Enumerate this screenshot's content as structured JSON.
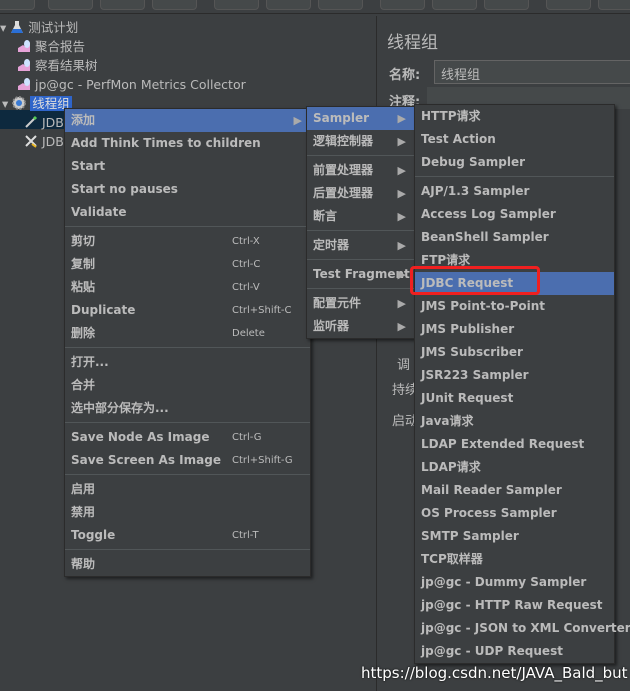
{
  "tree": {
    "items": [
      {
        "label": "测试计划",
        "icon": "test-plan-flask-icon"
      },
      {
        "label": "聚合报告",
        "icon": "listener-chart-icon"
      },
      {
        "label": "察看结果树",
        "icon": "listener-chart-icon"
      },
      {
        "label": "jp@gc - PerfMon Metrics Collector",
        "icon": "listener-chart-icon"
      },
      {
        "label": "线程组",
        "icon": "thread-group-gear-icon"
      },
      {
        "label": "JDB",
        "icon": "jdbc-dropper-icon"
      },
      {
        "label": "JDB",
        "icon": "config-tools-icon"
      }
    ]
  },
  "right_panel": {
    "title": "线程组",
    "name_label": "名称:",
    "name_value": "线程组",
    "comment_label": "注释:",
    "scheduler_label": "调",
    "duration_label": "持续",
    "startup_label": "启动"
  },
  "context_menu": [
    {
      "label": "添加",
      "submenu": true,
      "highlighted": true
    },
    {
      "sep": true
    },
    {
      "label": "Add Think Times to children"
    },
    {
      "label": "Start"
    },
    {
      "label": "Start no pauses"
    },
    {
      "label": "Validate"
    },
    {
      "sep": true
    },
    {
      "label": "剪切",
      "shortcut": "Ctrl-X"
    },
    {
      "label": "复制",
      "shortcut": "Ctrl-C"
    },
    {
      "label": "粘贴",
      "shortcut": "Ctrl-V"
    },
    {
      "label": "Duplicate",
      "shortcut": "Ctrl+Shift-C"
    },
    {
      "label": "删除",
      "shortcut": "Delete"
    },
    {
      "sep": true
    },
    {
      "label": "打开..."
    },
    {
      "label": "合并"
    },
    {
      "label": "选中部分保存为..."
    },
    {
      "sep": true
    },
    {
      "label": "Save Node As Image",
      "shortcut": "Ctrl-G"
    },
    {
      "label": "Save Screen As Image",
      "shortcut": "Ctrl+Shift-G"
    },
    {
      "sep": true
    },
    {
      "label": "启用"
    },
    {
      "label": "禁用"
    },
    {
      "label": "Toggle",
      "shortcut": "Ctrl-T"
    },
    {
      "sep": true
    },
    {
      "label": "帮助"
    }
  ],
  "add_submenu": [
    {
      "label": "Sampler",
      "submenu": true,
      "highlighted": true
    },
    {
      "label": "逻辑控制器",
      "submenu": true
    },
    {
      "sep": true
    },
    {
      "label": "前置处理器",
      "submenu": true
    },
    {
      "label": "后置处理器",
      "submenu": true
    },
    {
      "label": "断言",
      "submenu": true
    },
    {
      "sep": true
    },
    {
      "label": "定时器",
      "submenu": true
    },
    {
      "sep": true
    },
    {
      "label": "Test Fragment",
      "submenu": true
    },
    {
      "sep": true
    },
    {
      "label": "配置元件",
      "submenu": true
    },
    {
      "label": "监听器",
      "submenu": true
    }
  ],
  "sampler_submenu": [
    {
      "label": "HTTP请求"
    },
    {
      "label": "Test Action"
    },
    {
      "label": "Debug Sampler"
    },
    {
      "sep": true
    },
    {
      "label": "AJP/1.3 Sampler"
    },
    {
      "label": "Access Log Sampler"
    },
    {
      "label": "BeanShell Sampler"
    },
    {
      "label": "FTP请求"
    },
    {
      "label": "JDBC Request",
      "highlighted": true
    },
    {
      "label": "JMS Point-to-Point"
    },
    {
      "label": "JMS Publisher"
    },
    {
      "label": "JMS Subscriber"
    },
    {
      "label": "JSR223 Sampler"
    },
    {
      "label": "JUnit Request"
    },
    {
      "label": "Java请求"
    },
    {
      "label": "LDAP Extended Request"
    },
    {
      "label": "LDAP请求"
    },
    {
      "label": "Mail Reader Sampler"
    },
    {
      "label": "OS Process Sampler"
    },
    {
      "label": "SMTP Sampler"
    },
    {
      "label": "TCP取样器"
    },
    {
      "label": "jp@gc - Dummy Sampler"
    },
    {
      "label": "jp@gc - HTTP Raw Request"
    },
    {
      "label": "jp@gc - JSON to XML Converter"
    },
    {
      "label": "jp@gc - UDP Request"
    }
  ],
  "watermark": "https://blog.csdn.net/JAVA_Bald_but",
  "colors": {
    "background": "#3c3f41",
    "highlight": "#4b6eaf",
    "selection_box": "#f02020"
  }
}
